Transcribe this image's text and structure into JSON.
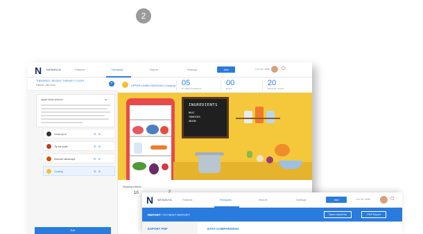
{
  "step_number": "2",
  "nav": {
    "logo_letter": "N",
    "brand": "NEMAVIA",
    "items": [
      "Patients",
      "Therapies",
      "Report",
      "Settings"
    ],
    "active": "Therapies",
    "add_label": "Add",
    "user": "Lino de Vitale"
  },
  "sidebar": {
    "breadcrumb": "THERAPIES / RECENT THERAPY / FLIGHT",
    "patient": "Patient: John Doe",
    "card_title": "Upper limbs session",
    "steps": [
      {
        "label": "Count up to",
        "icon_color": "#333333"
      },
      {
        "label": "Tip the scale",
        "icon_color": "#c0392b"
      },
      {
        "label": "Discover landscape",
        "icon_color": "#d35400"
      },
      {
        "label": "Cooking",
        "icon_color": "#f1c232",
        "active": true
      }
    ],
    "exit_label": "Exit"
  },
  "session": {
    "label": "UPPER LIMBS SESSION | Cooking",
    "stats": [
      {
        "value": "05",
        "label": "N° picked ingredients"
      },
      {
        "value": "00",
        "label": "Errors"
      },
      {
        "value": "20",
        "label": "Execution time(s)"
      }
    ]
  },
  "board": {
    "title": "INGREDIENTS",
    "items": [
      "MEAT",
      "TOMATOES",
      "ONION"
    ]
  },
  "criteria": {
    "label": "Stopping criterion",
    "value": "10",
    "right_value": "3"
  },
  "report_window": {
    "nav": {
      "logo_letter": "N",
      "brand": "NEMAVIA",
      "items": [
        "Patients",
        "Therapies",
        "Report",
        "Settings"
      ],
      "active": "Therapies",
      "add_label": "Add",
      "user": "Lino de Vitale"
    },
    "title_bold": "REPORT",
    "title_rest": " / PATIENT REPORT",
    "buttons": [
      "Open report list",
      "PDF Export"
    ],
    "export_label": "EXPORT PDF",
    "compare_label": "DATA COMPARISION"
  },
  "colors": {
    "accent": "#2a7bde",
    "scene": "#f5c83b",
    "danger": "#e15b5b"
  }
}
